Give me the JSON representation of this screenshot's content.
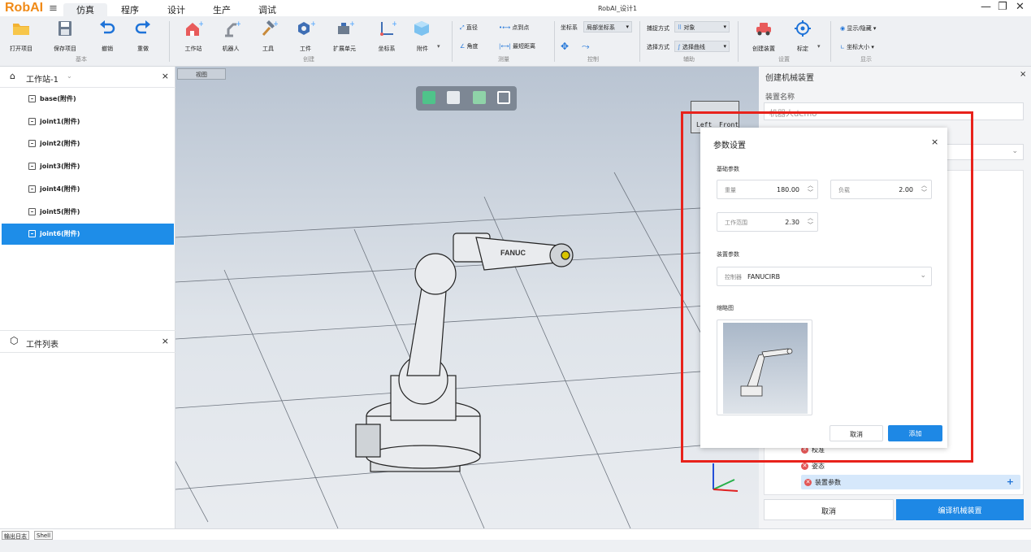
{
  "app": {
    "logo": "RobAI",
    "doc_title": "RobAI_设计1"
  },
  "menu": {
    "tabs": [
      "仿真",
      "程序",
      "设计",
      "生产",
      "调试"
    ],
    "active": "仿真"
  },
  "ribbon": {
    "basic": {
      "open": "打开项目",
      "save": "保存项目",
      "undo": "撤销",
      "redo": "重做",
      "group": "基本"
    },
    "create": {
      "station": "工作站",
      "robot": "机器人",
      "tool": "工具",
      "workpiece": "工件",
      "ext_unit": "扩展单元",
      "coord": "坐标系",
      "attachment": "附件",
      "group": "创建"
    },
    "measure": {
      "diameter": "直径",
      "p2p": "点到点",
      "angle": "角度",
      "min_dist": "最短距离",
      "group": "测量"
    },
    "control": {
      "coord_label": "坐标系",
      "coord_value": "局部坐标系",
      "group": "控制"
    },
    "assist": {
      "capture_label": "捕捉方式",
      "capture_value": "对象",
      "select_label": "选择方式",
      "select_value": "选择曲线",
      "group": "辅助"
    },
    "settings": {
      "create_device": "创建装置",
      "calibrate": "标定",
      "group": "设置"
    },
    "display": {
      "show_hide": "显示/隐藏",
      "coord_size": "坐标大小",
      "group": "显示"
    }
  },
  "left_panel": {
    "station_title": "工作站-1",
    "items": [
      "base(附件)",
      "joint1(附件)",
      "joint2(附件)",
      "joint3(附件)",
      "joint4(附件)",
      "joint5(附件)",
      "joint6(附件)"
    ],
    "selected_index": 6,
    "workpiece_title": "工件列表"
  },
  "viewport": {
    "tab": "视图",
    "cube_left": "Left",
    "cube_front": "Front",
    "robot_brand": "FANUC"
  },
  "right_panel": {
    "title": "创建机械装置",
    "name_label": "装置名称",
    "name_value": "机器人demo",
    "rows": [
      "校准",
      "姿态"
    ],
    "param_row": "装置参数",
    "cancel": "取消",
    "compile": "编译机械装置"
  },
  "dialog": {
    "title": "参数设置",
    "basic_section": "基础参数",
    "weight_label": "重量",
    "weight_value": "180.00",
    "load_label": "负载",
    "load_value": "2.00",
    "range_label": "工作范围",
    "range_value": "2.30",
    "device_section": "装置参数",
    "controller_label": "控制器",
    "controller_value": "FANUCIRB",
    "thumb_section": "缩略图",
    "cancel": "取消",
    "add": "添加"
  },
  "bottom": {
    "tabs": [
      "输出日志",
      "Shell"
    ]
  },
  "colors": {
    "accent": "#1e88e5",
    "logo": "#f08a17",
    "highlight": "#e8221b"
  }
}
